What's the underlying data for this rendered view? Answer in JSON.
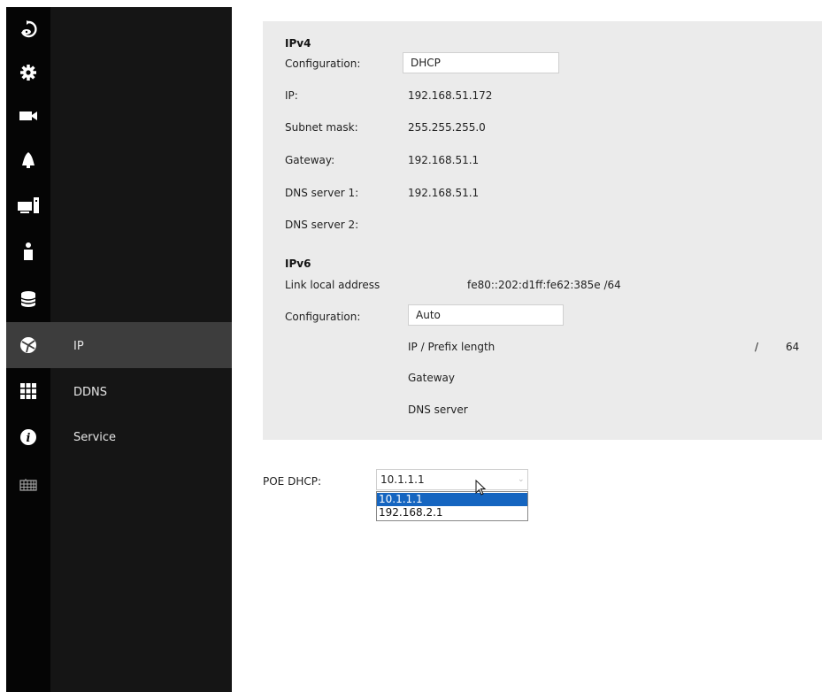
{
  "sidebar": {
    "icons": [
      "home-icon",
      "gear-icon",
      "video-camera-icon",
      "bell-icon",
      "monitor-icon",
      "person-icon",
      "database-icon",
      "network-globe-icon",
      "grid-icon",
      "info-icon",
      "keyboard-icon"
    ],
    "items": [
      {
        "label": "IP",
        "active": true
      },
      {
        "label": "DDNS"
      },
      {
        "label": "Service"
      }
    ]
  },
  "ipv4": {
    "heading": "IPv4",
    "configuration_label": "Configuration:",
    "configuration_value": "DHCP",
    "ip_label": "IP:",
    "ip_value": "192.168.51.172",
    "subnet_label": "Subnet mask:",
    "subnet_value": "255.255.255.0",
    "gateway_label": "Gateway:",
    "gateway_value": "192.168.51.1",
    "dns1_label": "DNS server 1:",
    "dns1_value": "192.168.51.1",
    "dns2_label": "DNS server 2:",
    "dns2_value": ""
  },
  "ipv6": {
    "heading": "IPv6",
    "link_local_label": "Link local address",
    "link_local_value": "fe80::202:d1ff:fe62:385e /64",
    "configuration_label": "Configuration:",
    "configuration_value": "Auto",
    "prefix_label": "IP / Prefix length",
    "prefix_slash": "/",
    "prefix_value": "64",
    "gateway_label": "Gateway",
    "dns_label": "DNS server"
  },
  "poe": {
    "label": "POE DHCP:",
    "selected": "10.1.1.1",
    "options": [
      "10.1.1.1",
      "192.168.2.1"
    ]
  },
  "colors": {
    "rail": "#050505",
    "submenu": "#151515",
    "active": "#3d3d3d",
    "panel": "#ebebeb",
    "highlight": "#1565c0"
  }
}
